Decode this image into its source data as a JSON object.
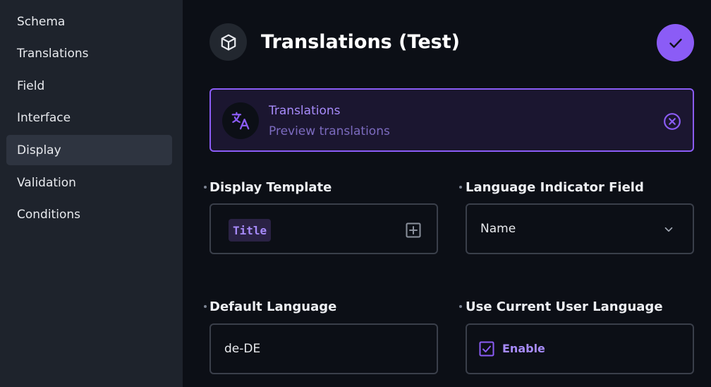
{
  "sidebar": {
    "items": [
      {
        "label": "Schema",
        "active": false
      },
      {
        "label": "Translations",
        "active": false
      },
      {
        "label": "Field",
        "active": false
      },
      {
        "label": "Interface",
        "active": false
      },
      {
        "label": "Display",
        "active": true
      },
      {
        "label": "Validation",
        "active": false
      },
      {
        "label": "Conditions",
        "active": false
      }
    ]
  },
  "header": {
    "title": "Translations (Test)",
    "icon": "cube-icon",
    "save_icon": "check-icon"
  },
  "notice": {
    "title": "Translations",
    "subtitle": "Preview translations",
    "icon": "translate-icon",
    "close_icon": "close-circle-icon"
  },
  "fields": {
    "display_template": {
      "label": "Display Template",
      "chip": "Title"
    },
    "language_indicator": {
      "label": "Language Indicator Field",
      "value": "Name"
    },
    "default_language": {
      "label": "Default Language",
      "value": "de-DE"
    },
    "use_user_language": {
      "label": "Use Current User Language",
      "checkbox_label": "Enable",
      "checked": true
    }
  },
  "colors": {
    "accent": "#8b5cf6",
    "accent_text": "#a78bfa",
    "sidebar_bg": "#1e232c",
    "main_bg": "#0c0f16",
    "border": "#3a3f4a"
  }
}
